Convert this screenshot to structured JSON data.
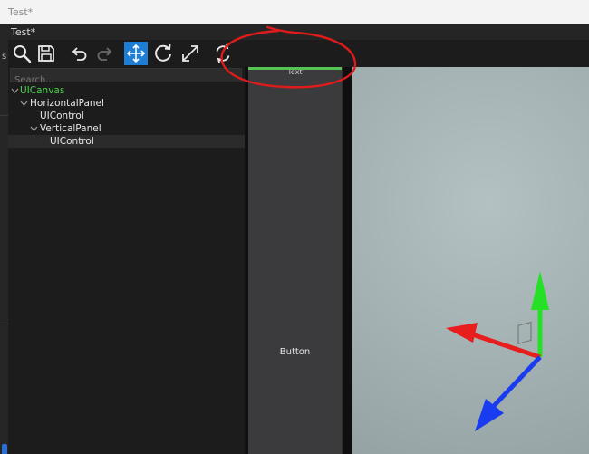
{
  "window": {
    "title": "Test*"
  },
  "editor": {
    "tab_title": "Test*"
  },
  "toolbar": {
    "tools": [
      {
        "name": "search",
        "icon": "search-icon"
      },
      {
        "name": "save",
        "icon": "save-icon"
      },
      {
        "name": "undo",
        "icon": "undo-icon"
      },
      {
        "name": "redo",
        "icon": "redo-icon"
      },
      {
        "name": "move",
        "icon": "move-icon",
        "active": true
      },
      {
        "name": "rotate",
        "icon": "rotate-icon"
      },
      {
        "name": "scale",
        "icon": "scale-icon"
      },
      {
        "name": "transform-space",
        "icon": "rotate-arrows-icon"
      }
    ],
    "active_color": "#1e7ed6"
  },
  "hierarchy": {
    "search": {
      "placeholder": "Search...",
      "value": ""
    },
    "items": [
      {
        "label": "UICanvas",
        "expanded": true,
        "level": 0
      },
      {
        "label": "HorizontalPanel",
        "expanded": true,
        "level": 1
      },
      {
        "label": "UIControl",
        "level": 2
      },
      {
        "label": "VerticalPanel",
        "expanded": true,
        "level": 2
      },
      {
        "label": "UIControl",
        "level": 3
      }
    ]
  },
  "viewport": {
    "button_label": "Button",
    "top_label": "Text",
    "gizmo": {
      "x_color": "#e81d1d",
      "y_color": "#26e026",
      "z_color": "#1a3cf0"
    }
  },
  "annotation": {
    "color": "#e01b1b"
  },
  "left_edge": {
    "letter": "s"
  }
}
